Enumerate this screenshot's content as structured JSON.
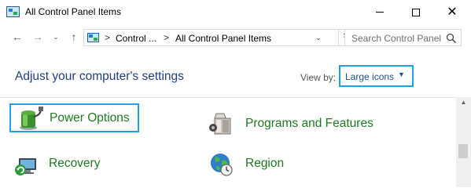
{
  "window": {
    "title": "All Control Panel Items",
    "minimize_icon": "minimize-icon",
    "maximize_icon": "maximize-icon",
    "close_glyph": "✕"
  },
  "nav": {
    "back_glyph": "←",
    "forward_glyph": "→",
    "dropdown_glyph": "⌄",
    "up_glyph": "↑",
    "breadcrumb": [
      "Control ...",
      "All Control Panel Items"
    ],
    "separator": ">",
    "refresh_glyph": "↻",
    "search_placeholder": "Search Control Panel"
  },
  "header": {
    "title": "Adjust your computer's settings",
    "view_by_label": "View by:",
    "view_by_value": "Large icons",
    "view_by_caret": "▼"
  },
  "items": [
    {
      "label": "Power Options",
      "icon": "power-options-icon",
      "selected": true
    },
    {
      "label": "Programs and Features",
      "icon": "programs-features-icon",
      "selected": false
    },
    {
      "label": "Recovery",
      "icon": "recovery-icon",
      "selected": false
    },
    {
      "label": "Region",
      "icon": "region-globe-icon",
      "selected": false
    }
  ],
  "colors": {
    "accent_highlight": "#1fa2dd",
    "heading": "#1e3f80",
    "item_label": "#1e7a1e"
  }
}
